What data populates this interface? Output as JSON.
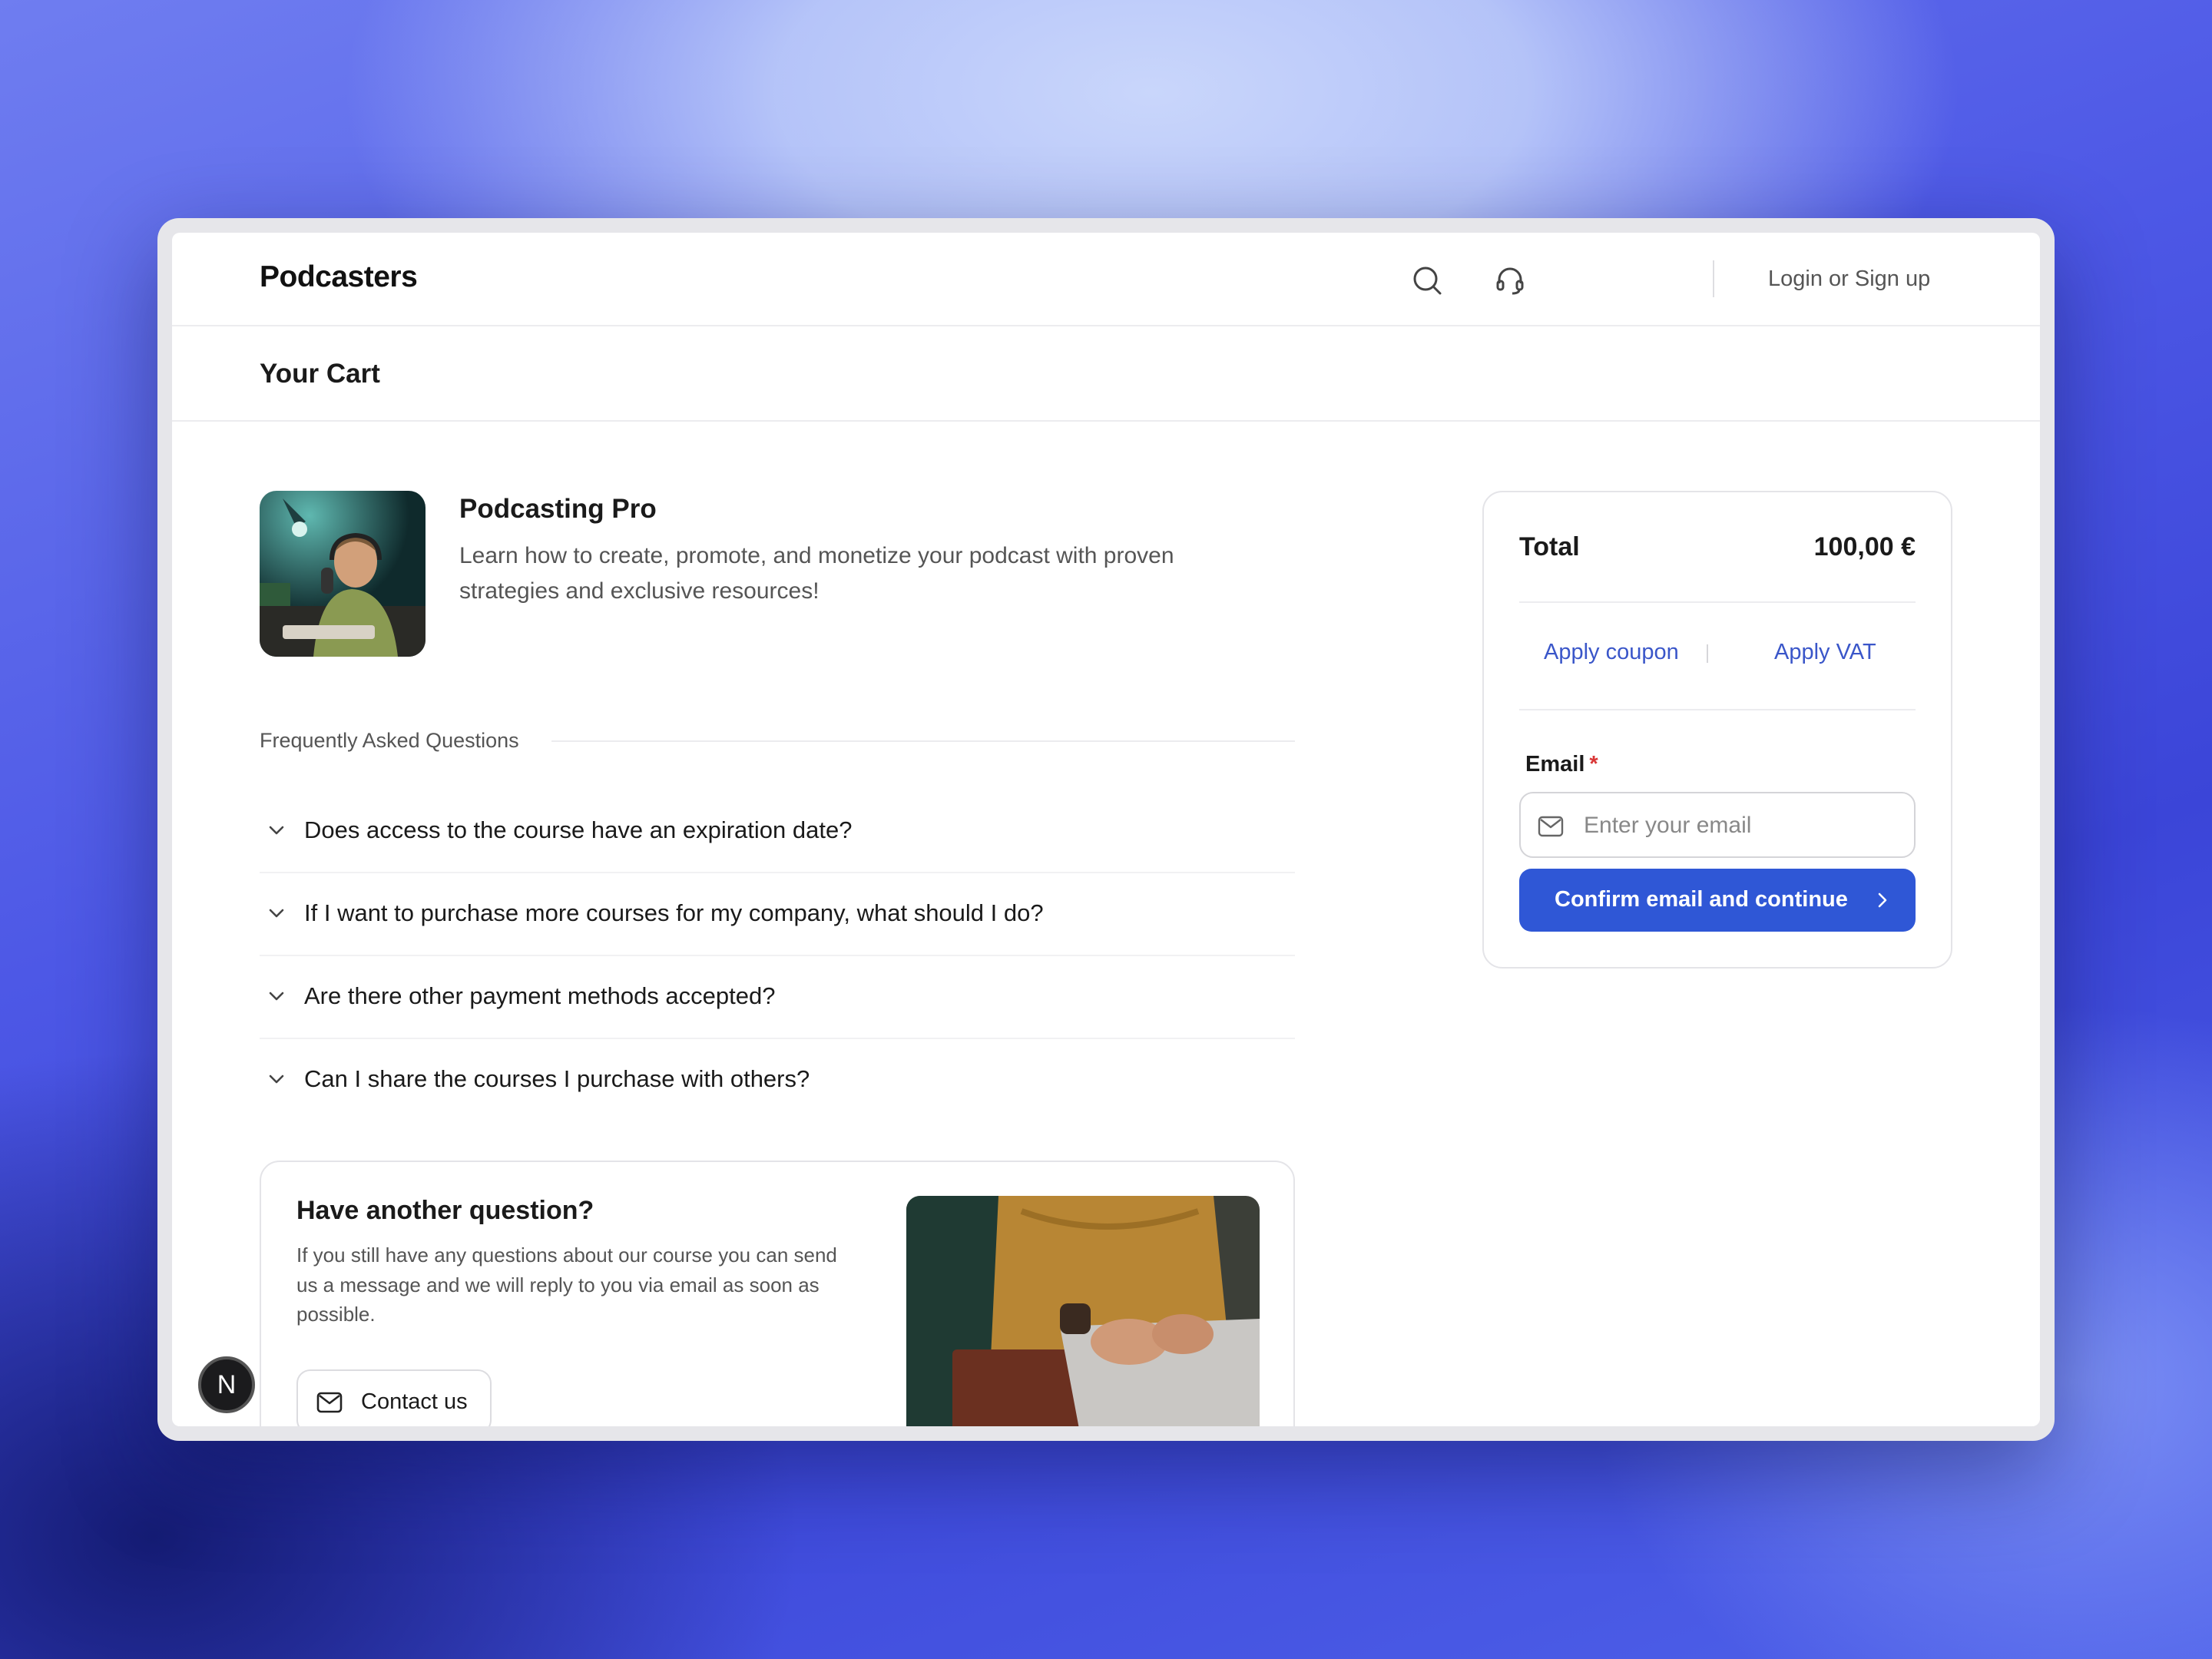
{
  "header": {
    "brand": "Podcasters",
    "login_label": "Login or Sign up",
    "icons": [
      "search-icon",
      "headset-icon"
    ]
  },
  "page": {
    "title": "Your Cart"
  },
  "product": {
    "title": "Podcasting Pro",
    "description": "Learn how to create, promote, and monetize your podcast with proven strategies and exclusive resources!"
  },
  "faq": {
    "heading": "Frequently Asked Questions",
    "items": [
      {
        "question": "Does access to the course have an expiration date?"
      },
      {
        "question": "If I want to purchase more courses for my company, what should I do?"
      },
      {
        "question": "Are there other payment methods accepted?"
      },
      {
        "question": "Can I share the courses I purchase with others?"
      }
    ]
  },
  "help_card": {
    "title": "Have another question?",
    "text": "If you still have any questions about our course you can send us a message and we will reply to you via email as soon as possible.",
    "button_label": "Contact us"
  },
  "summary": {
    "total_label": "Total",
    "total_amount": "100,00 €",
    "apply_coupon": "Apply coupon",
    "apply_vat": "Apply VAT",
    "email_label": "Email",
    "required_mark": "*",
    "email_placeholder": "Enter your email",
    "email_value": "",
    "confirm_label": "Confirm email and continue"
  },
  "badge": {
    "letter": "N"
  },
  "colors": {
    "accent": "#2f57d6",
    "link": "#3a56c9",
    "required": "#d93636"
  }
}
